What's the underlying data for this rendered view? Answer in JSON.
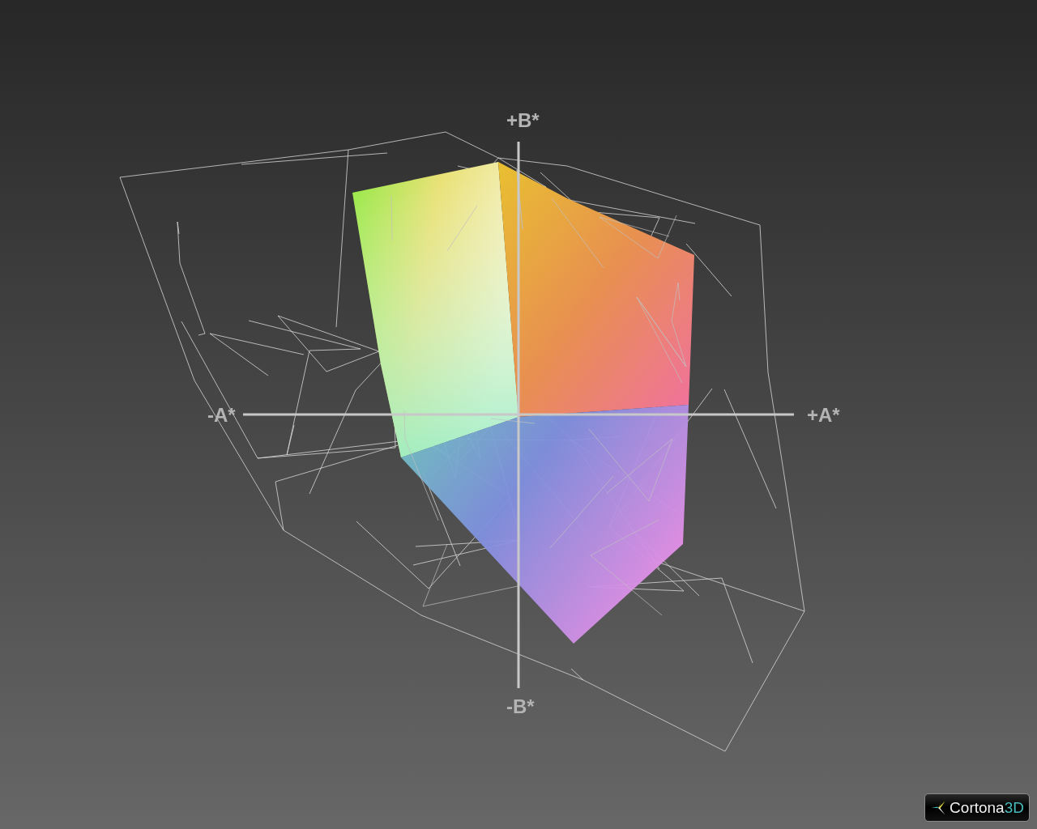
{
  "viewer": {
    "axis_labels": [
      {
        "kind": "top",
        "text": "+B*"
      },
      {
        "kind": "left",
        "text": "-A*"
      },
      {
        "kind": "right",
        "text": "+A*"
      },
      {
        "kind": "bottom",
        "text": "-B*"
      }
    ]
  },
  "logo": {
    "text": "Cortona",
    "suffix": "3D"
  }
}
